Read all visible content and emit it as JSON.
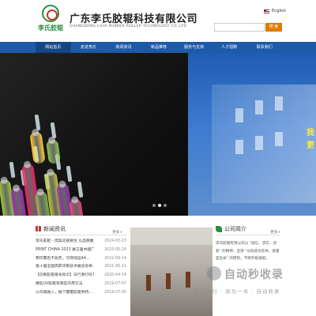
{
  "header": {
    "logo_text": "李氏胶辊",
    "company_cn": "广东李氏胶辊科技有限公司",
    "company_en": "GUANGDONG LISHI RUBBER ROLLER TECHNOLOGY CO.,LTD",
    "language": "English",
    "search_placeholder": "",
    "search_button": "搜 索"
  },
  "nav": {
    "items": [
      "网站首页",
      "走进李氏",
      "新闻资讯",
      "新品推荐",
      "服务与支持",
      "人才招聘",
      "联系我们"
    ],
    "active_index": 0
  },
  "banner": {
    "right_text": "我",
    "right_text2": "更",
    "slide_count": 3,
    "active_slide": 1
  },
  "news": {
    "title": "新闻资讯",
    "more": "更多+",
    "items": [
      {
        "text": "李氏胶辊 - 周案这接接住 以品质赢...",
        "date": "2024-03-13"
      },
      {
        "text": "PRINT CHINA 2023 展王届中国广...",
        "date": "2023-05-24"
      },
      {
        "text": "那印覆色不收告，可持续运A4...",
        "date": "2022-09-14"
      },
      {
        "text": "第十届全国高职印刷技术展览会举...",
        "date": "2021-06-21"
      },
      {
        "text": "【印刷胶辊基本知识】白行事行吗?",
        "date": "2020-04-14"
      },
      {
        "text": "橡胶UV胶辊有哪些作用方法",
        "date": "2019-07-07"
      },
      {
        "text": "公司再融入，做下覆覆胶辊到特...",
        "date": "2019-07-05"
      }
    ]
  },
  "about": {
    "title": "公司简介",
    "more": "更多+",
    "text": "李氏胶辊有限公司以 \"诚信、求实、创新\" 的精神，坚持 \"以科技为先导，质量是生命\" 的原则，不断开拓进取。"
  },
  "watermark": {
    "title": "自动秒收录",
    "sub": "数上排行 · 收功一本 · 自动收录"
  },
  "colors": {
    "nav_bg": "#1d5aa7",
    "search_btn": "#e07b00",
    "brand_green": "#2a8f3e"
  }
}
